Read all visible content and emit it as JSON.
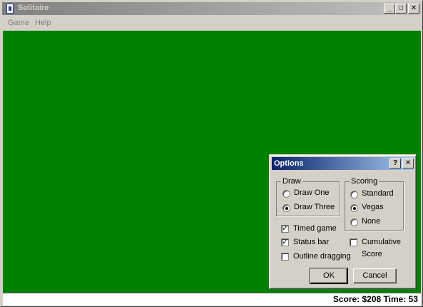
{
  "window": {
    "title": "Solitaire",
    "minimize_glyph": "_",
    "maximize_glyph": "□",
    "close_glyph": "✕"
  },
  "menu": {
    "items": [
      {
        "label": "Game"
      },
      {
        "label": "Help"
      }
    ]
  },
  "felt": {
    "color": "#008000"
  },
  "status": {
    "text": "Score: $208 Time: 53"
  },
  "dialog": {
    "title": "Options",
    "help_glyph": "?",
    "close_glyph": "✕",
    "draw": {
      "label": "Draw",
      "options": [
        {
          "label": "Draw One",
          "checked": false
        },
        {
          "label": "Draw Three",
          "checked": true
        }
      ]
    },
    "scoring": {
      "label": "Scoring",
      "options": [
        {
          "label": "Standard",
          "checked": false
        },
        {
          "label": "Vegas",
          "checked": true
        },
        {
          "label": "None",
          "checked": false
        }
      ]
    },
    "checkboxes": [
      {
        "label": "Timed game",
        "checked": true
      },
      {
        "label": "Status bar",
        "checked": true
      },
      {
        "label": "Outline dragging",
        "checked": false
      }
    ],
    "cumulative": {
      "label_line1": "Cumulative",
      "label_line2": "Score",
      "checked": false
    },
    "ok_label": "OK",
    "cancel_label": "Cancel"
  }
}
